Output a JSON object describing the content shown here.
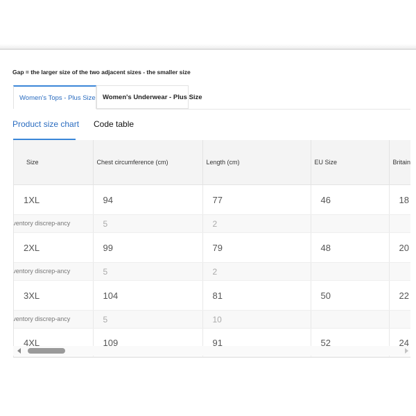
{
  "note": "Gap = the larger size of the two adjacent sizes - the smaller size",
  "tabs": [
    {
      "label": "Women's Tops - Plus Size",
      "active": true
    },
    {
      "label": "Women's Underwear - Plus Size",
      "active": false
    }
  ],
  "subtabs": [
    {
      "label": "Product size chart",
      "active": true
    },
    {
      "label": "Code table",
      "active": false
    }
  ],
  "table": {
    "headers": [
      "Size",
      "Chest circumference (cm)",
      "Length (cm)",
      "EU Size",
      "Britain"
    ],
    "rows": [
      {
        "type": "size",
        "cells": [
          "1XL",
          "94",
          "77",
          "46",
          "18"
        ]
      },
      {
        "type": "gap",
        "cells": [
          "Inventory discrep-ancy",
          "5",
          "2",
          "",
          ""
        ]
      },
      {
        "type": "size",
        "cells": [
          "2XL",
          "99",
          "79",
          "48",
          "20"
        ]
      },
      {
        "type": "gap",
        "cells": [
          "Inventory discrep-ancy",
          "5",
          "2",
          "",
          ""
        ]
      },
      {
        "type": "size",
        "cells": [
          "3XL",
          "104",
          "81",
          "50",
          "22"
        ]
      },
      {
        "type": "gap",
        "cells": [
          "Inventory discrep-ancy",
          "5",
          "10",
          "",
          ""
        ]
      },
      {
        "type": "size",
        "cells": [
          "4XL",
          "109",
          "91",
          "52",
          "24"
        ]
      }
    ]
  },
  "colors": {
    "accent": "#2a6cc0",
    "header_bg": "#f4f4f4",
    "gap_bg": "#f8f8f8"
  },
  "icons": {
    "scroll_left": "triangle-left-icon",
    "scroll_right": "triangle-right-icon"
  }
}
